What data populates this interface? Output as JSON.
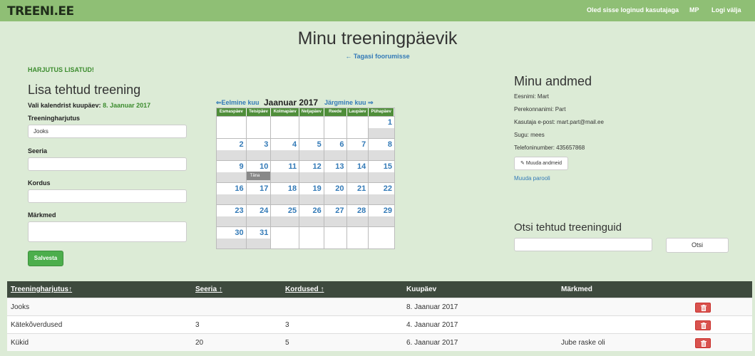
{
  "navbar": {
    "brand": "TREENI.EE",
    "logged_in_text": "Oled sisse loginud kasutajaga",
    "user": "MP",
    "logout": "Logi välja"
  },
  "header": {
    "title": "Minu treeningpäevik",
    "back_link": "← Tagasi foorumisse"
  },
  "form": {
    "success": "HARJUTUS LISATUD!",
    "title": "Lisa tehtud treening",
    "date_prompt": "Vali kalendrist kuupäev:",
    "date_value": "8. Jaanuar 2017",
    "exercise_label": "Treeningharjutus",
    "exercise_value": "Jooks",
    "sets_label": "Seeria",
    "reps_label": "Kordus",
    "notes_label": "Märkmed",
    "save_button": "Salvesta"
  },
  "calendar": {
    "prev": "⇐Eelmine kuu",
    "month": "Jaanuar 2017",
    "next": "Järgmine kuu ⇒",
    "weekdays": [
      "Esmaspäev",
      "Teisipäev",
      "Kolmapäev",
      "Neljapäev",
      "Reede",
      "Laupäev",
      "Pühapäev"
    ],
    "today_label": "Täna",
    "weeks": [
      [
        "",
        "",
        "",
        "",
        "",
        "",
        "1"
      ],
      [
        "2",
        "3",
        "4",
        "5",
        "6",
        "7",
        "8"
      ],
      [
        "9",
        "10",
        "11",
        "12",
        "13",
        "14",
        "15"
      ],
      [
        "16",
        "17",
        "18",
        "19",
        "20",
        "21",
        "22"
      ],
      [
        "23",
        "24",
        "25",
        "26",
        "27",
        "28",
        "29"
      ],
      [
        "30",
        "31",
        "",
        "",
        "",
        "",
        ""
      ]
    ]
  },
  "my_data": {
    "title": "Minu andmed",
    "first_name": "Eesnimi: Mart",
    "last_name": "Perekonnanimi: Part",
    "email": "Kasutaja e-post: mart.part@mail.ee",
    "gender": "Sugu: mees",
    "phone": "Telefoninumber: 435657868",
    "edit_button": "Muuda andmeid",
    "change_password": "Muuda parooli"
  },
  "search": {
    "title": "Otsi tehtud treeninguid",
    "button": "Otsi"
  },
  "table": {
    "headers": [
      "Treeningharjutus↑",
      "Seeria ↑",
      "Kordused ↑",
      "Kuupäev",
      "Märkmed"
    ],
    "rows": [
      [
        "Jooks",
        "",
        "",
        "8. Jaanuar 2017",
        ""
      ],
      [
        "Kätekõverdused",
        "3",
        "3",
        "4. Jaanuar 2017",
        ""
      ],
      [
        "Kükid",
        "20",
        "5",
        "6. Jaanuar 2017",
        "Jube raske oli"
      ]
    ]
  },
  "colors": {
    "navbar": "#8fbf75",
    "background": "#dcebd6",
    "calendar_header": "#4f8e3a",
    "table_header": "#3e4a3e",
    "delete": "#d9534f",
    "link": "#337ab7"
  }
}
